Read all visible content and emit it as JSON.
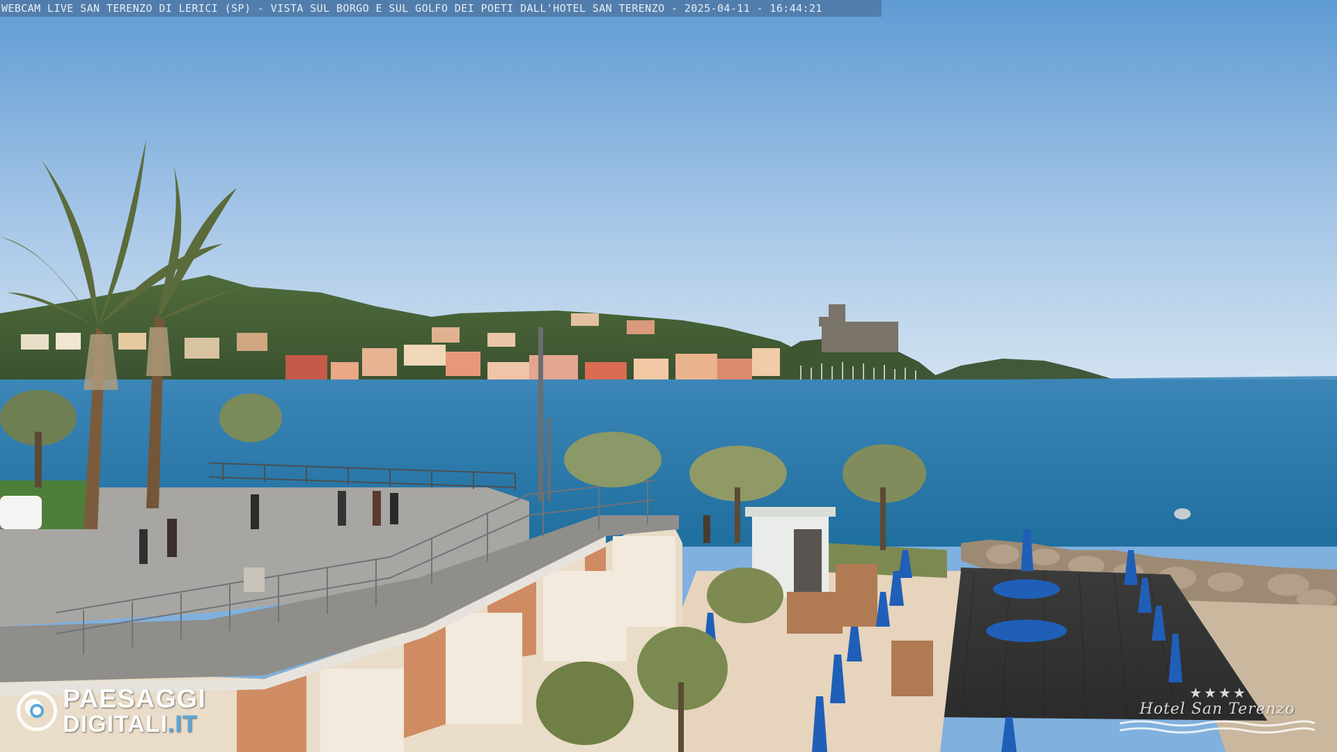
{
  "overlay": {
    "title": "WEBCAM LIVE SAN TERENZO DI LERICI (SP) - VISTA SUL BORGO E SUL GOLFO DEI POETI DALL'HOTEL SAN TERENZO - 2025-04-11 - 16:44:21"
  },
  "watermark_left": {
    "line1": "PAESAGGI",
    "line2": "DIGITALI",
    "line2_suffix": ".IT",
    "accent": "#4aa3df"
  },
  "watermark_right": {
    "stars": "★★★★",
    "name": "Hotel San Terenzo"
  },
  "colors": {
    "sky_top": "#5e9bd3",
    "sky_bottom": "#c9ddef",
    "sea": "#2f7db0",
    "umbrella": "#1f5fb8"
  }
}
